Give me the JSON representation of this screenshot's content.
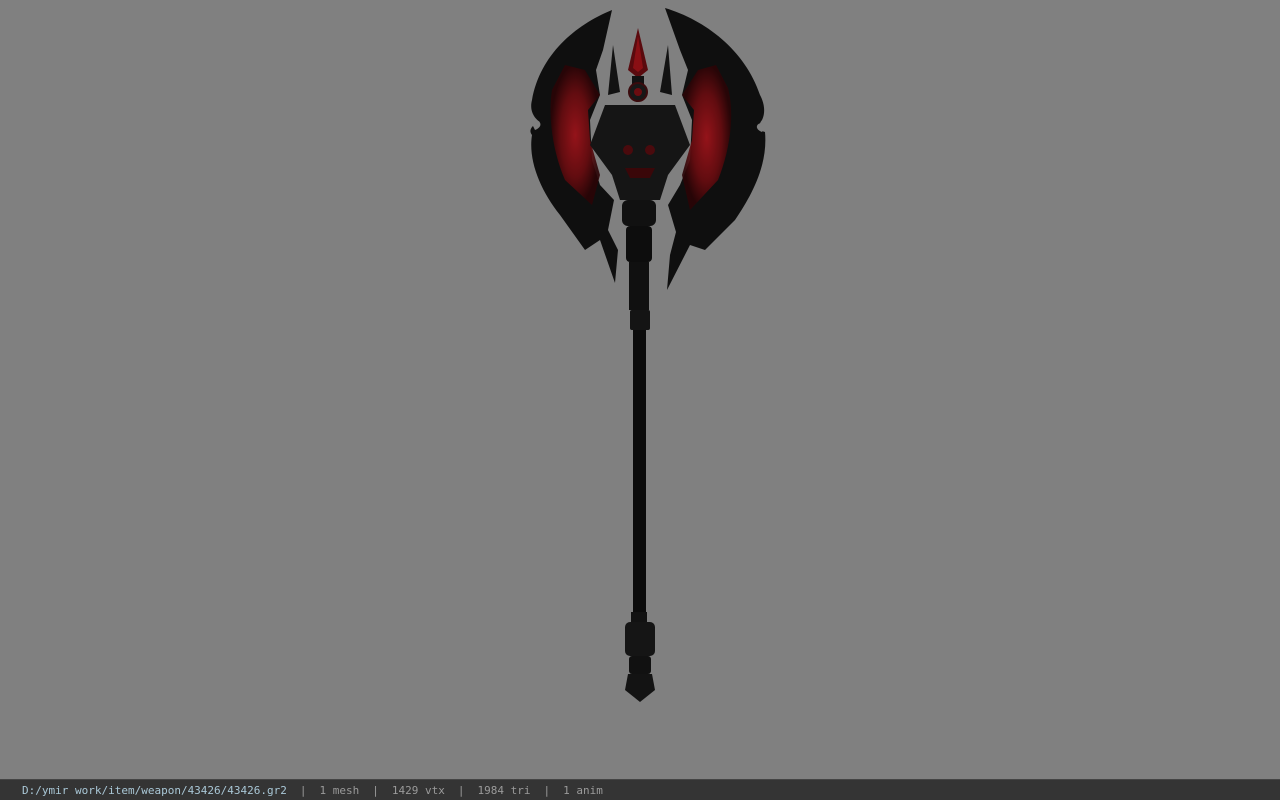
{
  "viewport": {
    "background_color": "#808080",
    "model": {
      "name": "axe-model",
      "colors": {
        "body": "#0e0e0e",
        "accent": "#8a0f14",
        "edge": "#1c1c1c"
      }
    }
  },
  "status_bar": {
    "file_path": "D:/ymir work/item/weapon/43426/43426.gr2",
    "mesh": "1 mesh",
    "vertices": "1429 vtx",
    "triangles": "1984 tri",
    "animations": "1 anim",
    "separator": "|",
    "colors": {
      "background": "#343434",
      "path": "#a9c7d6",
      "text": "#9a9a9a"
    }
  }
}
